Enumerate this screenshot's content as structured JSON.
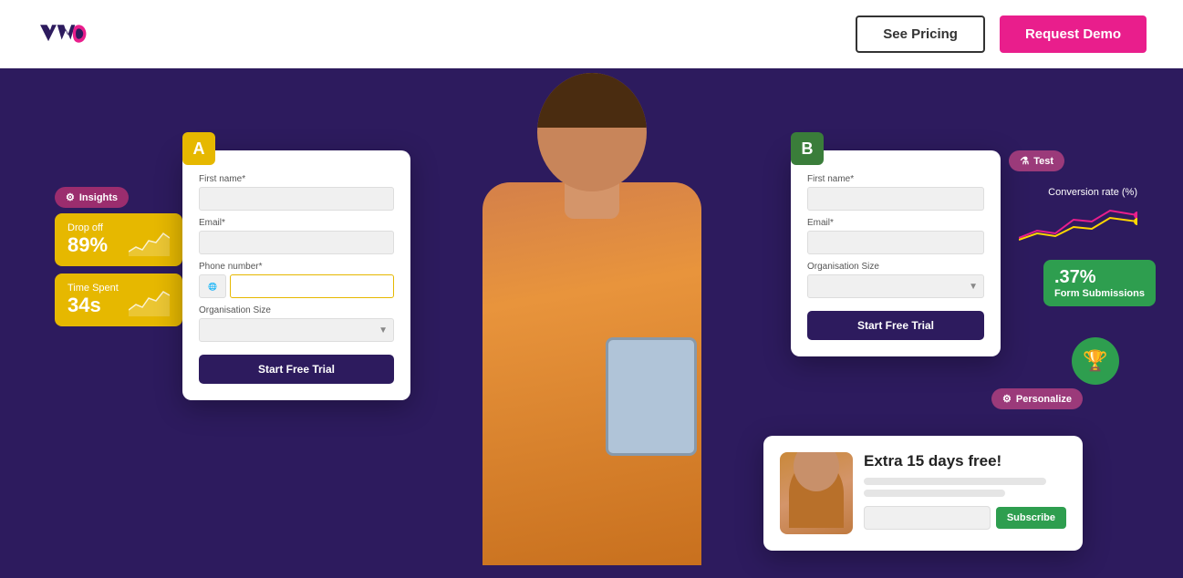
{
  "header": {
    "logo_alt": "VWO",
    "see_pricing_label": "See Pricing",
    "request_demo_label": "Request Demo"
  },
  "hero": {
    "form_a": {
      "variant_label": "A",
      "first_name_label": "First name*",
      "email_label": "Email*",
      "phone_label": "Phone number*",
      "org_label": "Organisation Size",
      "btn_label": "Start Free Trial"
    },
    "form_b": {
      "variant_label": "B",
      "first_name_label": "First name*",
      "email_label": "Email*",
      "org_label": "Organisation Size",
      "btn_label": "Start Free Trial"
    },
    "test_badge": "Test",
    "insights_badge": "Insights",
    "personalize_badge": "Personalize",
    "drop_off_label": "Drop off",
    "drop_off_value": "89%",
    "time_spent_label": "Time Spent",
    "time_spent_value": "34s",
    "conversion_label": "Conversion rate (%)",
    "form_submissions_percent": ".37%",
    "form_submissions_label": "Form Submissions",
    "personalize_title": "Extra 15 days free!",
    "subscribe_label": "Subscribe"
  }
}
